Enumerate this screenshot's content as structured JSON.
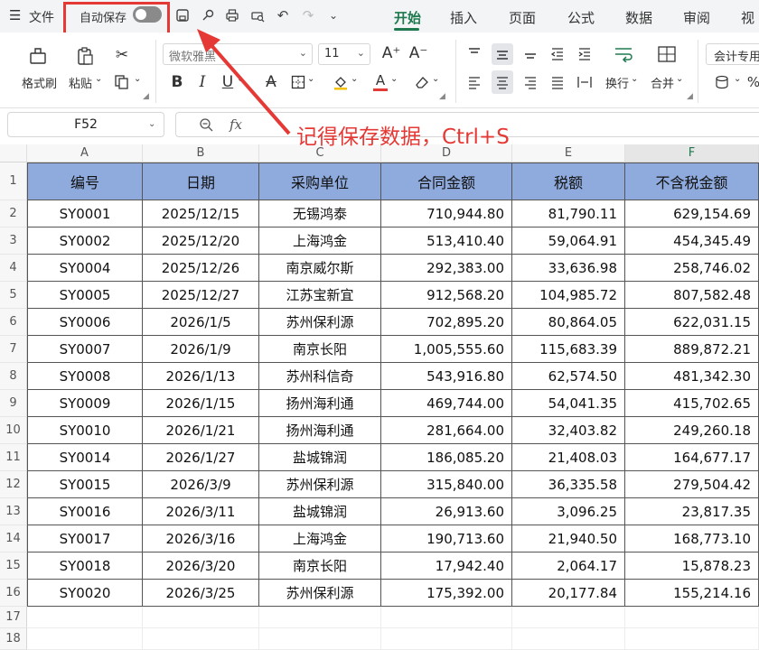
{
  "topbar": {
    "file_label": "文件",
    "autosave_label": "自动保存",
    "tabs": [
      {
        "label": "开始",
        "active": true
      },
      {
        "label": "插入",
        "active": false
      },
      {
        "label": "页面",
        "active": false
      },
      {
        "label": "公式",
        "active": false
      },
      {
        "label": "数据",
        "active": false
      },
      {
        "label": "审阅",
        "active": false
      },
      {
        "label": "视",
        "active": false
      }
    ]
  },
  "ribbon": {
    "format_painter_label": "格式刷",
    "paste_label": "粘贴",
    "font_name": "微软雅黑",
    "font_size": "11",
    "wrap_label": "换行",
    "merge_label": "合并",
    "number_format": "会计专用"
  },
  "formula_bar": {
    "cell_ref": "F52",
    "fx_label": "fx"
  },
  "annotation": {
    "text": "记得保存数据，Ctrl+S",
    "color": "#e53935"
  },
  "sheet": {
    "columns": [
      "A",
      "B",
      "C",
      "D",
      "E",
      "F"
    ],
    "rows": [
      "1",
      "2",
      "3",
      "4",
      "5",
      "6",
      "7",
      "8",
      "9",
      "10",
      "11",
      "12",
      "13",
      "14",
      "15",
      "16",
      "17",
      "18"
    ],
    "headers": [
      "编号",
      "日期",
      "采购单位",
      "合同金额",
      "税额",
      "不含税金额"
    ],
    "data": [
      [
        "SY0001",
        "2025/12/15",
        "无锡鸿泰",
        "710,944.80",
        "81,790.11",
        "629,154.69"
      ],
      [
        "SY0002",
        "2025/12/20",
        "上海鸿金",
        "513,410.40",
        "59,064.91",
        "454,345.49"
      ],
      [
        "SY0004",
        "2025/12/26",
        "南京威尔斯",
        "292,383.00",
        "33,636.98",
        "258,746.02"
      ],
      [
        "SY0005",
        "2025/12/27",
        "江苏宝新宜",
        "912,568.20",
        "104,985.72",
        "807,582.48"
      ],
      [
        "SY0006",
        "2026/1/5",
        "苏州保利源",
        "702,895.20",
        "80,864.05",
        "622,031.15"
      ],
      [
        "SY0007",
        "2026/1/9",
        "南京长阳",
        "1,005,555.60",
        "115,683.39",
        "889,872.21"
      ],
      [
        "SY0008",
        "2026/1/13",
        "苏州科信奇",
        "543,916.80",
        "62,574.50",
        "481,342.30"
      ],
      [
        "SY0009",
        "2026/1/15",
        "扬州海利通",
        "469,744.00",
        "54,041.35",
        "415,702.65"
      ],
      [
        "SY0010",
        "2026/1/21",
        "扬州海利通",
        "281,664.00",
        "32,403.82",
        "249,260.18"
      ],
      [
        "SY0014",
        "2026/1/27",
        "盐城锦润",
        "186,085.20",
        "21,408.03",
        "164,677.17"
      ],
      [
        "SY0015",
        "2026/3/9",
        "苏州保利源",
        "315,840.00",
        "36,335.58",
        "279,504.42"
      ],
      [
        "SY0016",
        "2026/3/11",
        "盐城锦润",
        "26,913.60",
        "3,096.25",
        "23,817.35"
      ],
      [
        "SY0017",
        "2026/3/16",
        "上海鸿金",
        "190,713.60",
        "21,940.50",
        "168,773.10"
      ],
      [
        "SY0018",
        "2026/3/20",
        "南京长阳",
        "17,942.40",
        "2,064.17",
        "15,878.23"
      ],
      [
        "SY0020",
        "2026/3/25",
        "苏州保利源",
        "175,392.00",
        "20,177.84",
        "155,214.16"
      ]
    ],
    "header_fill": "#8faadc"
  }
}
